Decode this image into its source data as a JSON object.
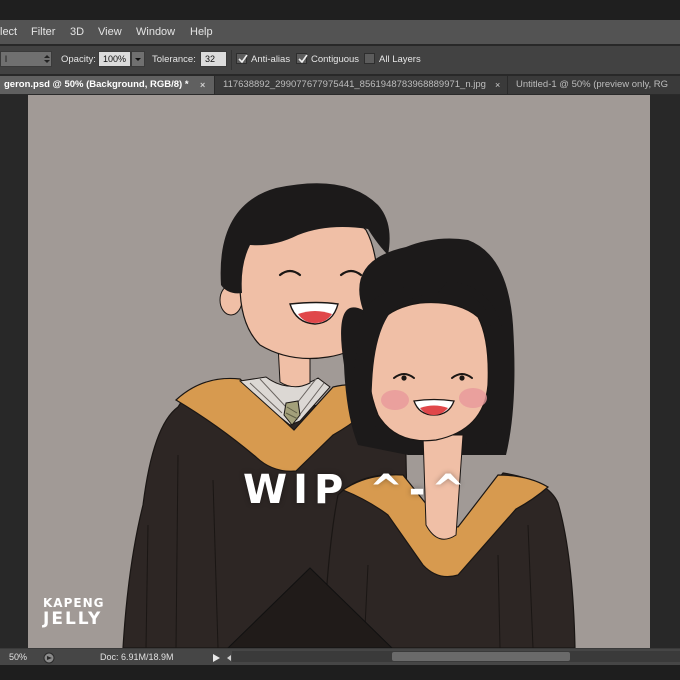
{
  "menu": {
    "items": [
      "lect",
      "Filter",
      "3D",
      "View",
      "Window",
      "Help"
    ]
  },
  "options": {
    "mode_value": "l",
    "opacity_label": "Opacity:",
    "opacity_value": "100%",
    "tolerance_label": "Tolerance:",
    "tolerance_value": "32",
    "anti_alias_label": "Anti-alias",
    "anti_alias_checked": true,
    "contiguous_label": "Contiguous",
    "contiguous_checked": true,
    "all_layers_label": "All Layers",
    "all_layers_checked": false
  },
  "tabs": [
    {
      "label": "geron.psd @ 50% (Background, RGB/8) *",
      "close": "×",
      "active": true
    },
    {
      "label": "117638892_299077677975441_8561948783968889971_n.jpg",
      "close": "×",
      "active": false
    },
    {
      "label": "Untitled-1 @ 50% (preview only, RG",
      "close": "",
      "active": false
    }
  ],
  "canvas": {
    "background_color": "#a19a96",
    "overlay_text": "WIP ^-^",
    "watermark_line1": "KAPENG",
    "watermark_line2": "JELLY"
  },
  "status": {
    "zoom": "50%",
    "doc_info": "Doc: 6.91M/18.9M"
  },
  "colors": {
    "menubar": "#535353",
    "optionsbar": "#424242",
    "workspace": "#282828",
    "gown": "#2d2624",
    "hood_gold": "#d79a4f",
    "skin": "#f0bfa6",
    "hair": "#1c1a1a"
  }
}
